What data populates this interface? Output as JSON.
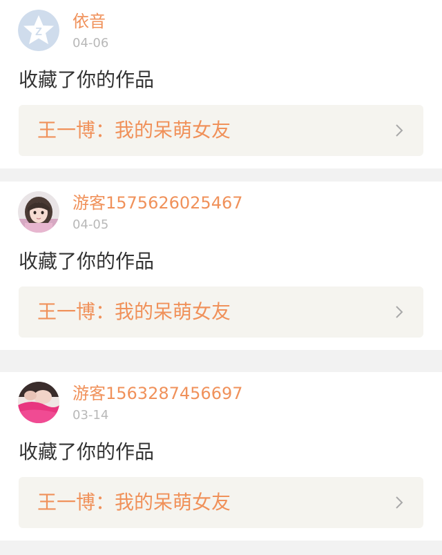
{
  "notifications": [
    {
      "username": "依音",
      "date": "04-06",
      "action": "收藏了你的作品",
      "work_title": "王一博：我的呆萌女友",
      "avatar_icon": "qzone-star-icon"
    },
    {
      "username": "游客1575626025467",
      "date": "04-05",
      "action": "收藏了你的作品",
      "work_title": "王一博：我的呆萌女友",
      "avatar_icon": "girl-photo-avatar"
    },
    {
      "username": "游客1563287456697",
      "date": "03-14",
      "action": "收藏了你的作品",
      "work_title": "王一博：我的呆萌女友",
      "avatar_icon": "pink-photo-avatar"
    }
  ],
  "colors": {
    "accent": "#f0915a",
    "date": "#b8b8b8",
    "action_text": "#333333",
    "link_background": "#f5f4ef",
    "separator": "#f2f2f2"
  }
}
